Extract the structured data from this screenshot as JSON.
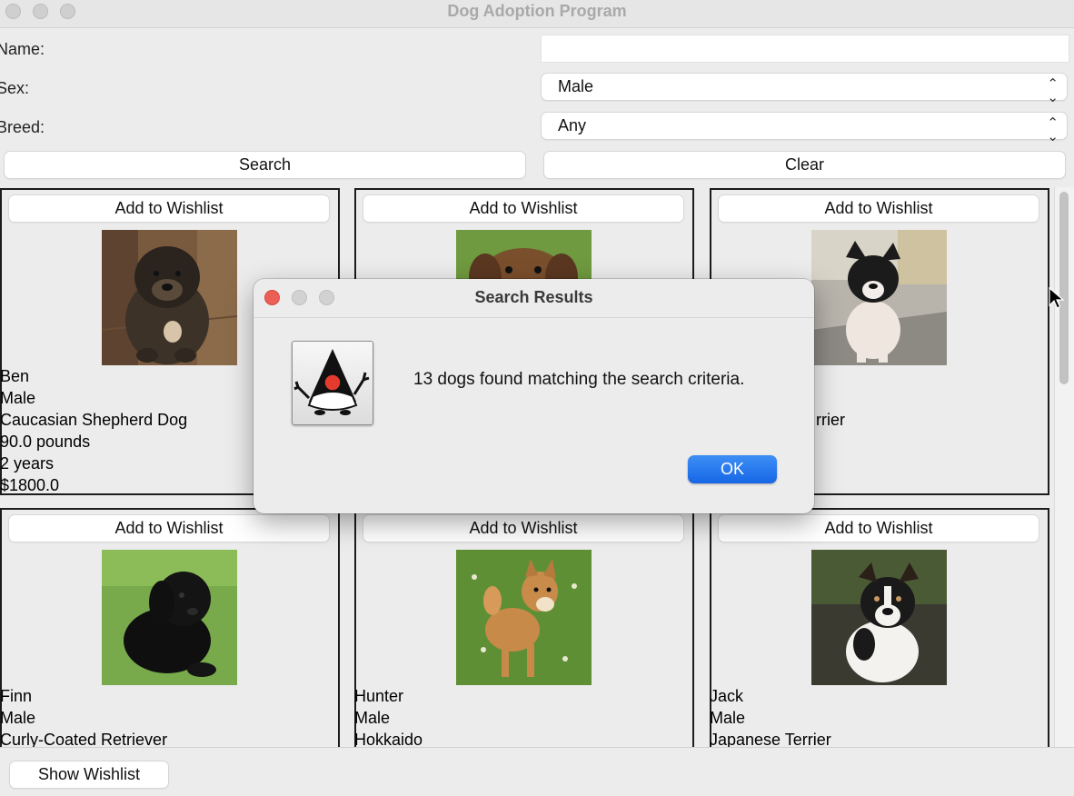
{
  "window": {
    "title": "Dog Adoption Program"
  },
  "form": {
    "name_label": "Name:",
    "name_value": "",
    "sex_label": "Sex:",
    "sex_value": "Male",
    "breed_label": "Breed:",
    "breed_value": "Any",
    "search_label": "Search",
    "clear_label": "Clear"
  },
  "cards": [
    {
      "wishlist_label": "Add to Wishlist",
      "name": "Ben",
      "sex": "Male",
      "breed": "Caucasian Shepherd Dog",
      "weight": "90.0 pounds",
      "age": "2 years",
      "price": "$1800.0"
    },
    {
      "wishlist_label": "Add to Wishlist"
    },
    {
      "wishlist_label": "Add to Wishlist",
      "breed_fragment": "rrier"
    },
    {
      "wishlist_label": "Add to Wishlist",
      "name": "Finn",
      "sex": "Male",
      "breed": "Curly-Coated Retriever"
    },
    {
      "wishlist_label": "Add to Wishlist",
      "name": "Hunter",
      "sex": "Male",
      "breed": "Hokkaido"
    },
    {
      "wishlist_label": "Add to Wishlist",
      "name": "Jack",
      "sex": "Male",
      "breed": "Japanese Terrier"
    }
  ],
  "footer": {
    "show_wishlist_label": "Show Wishlist"
  },
  "dialog": {
    "title": "Search Results",
    "message": "13 dogs found matching the search criteria.",
    "ok_label": "OK",
    "icon": "java-duke-icon"
  },
  "colors": {
    "accent": "#1f6fef",
    "window_bg": "#ececec",
    "close_red": "#ec5f57"
  }
}
